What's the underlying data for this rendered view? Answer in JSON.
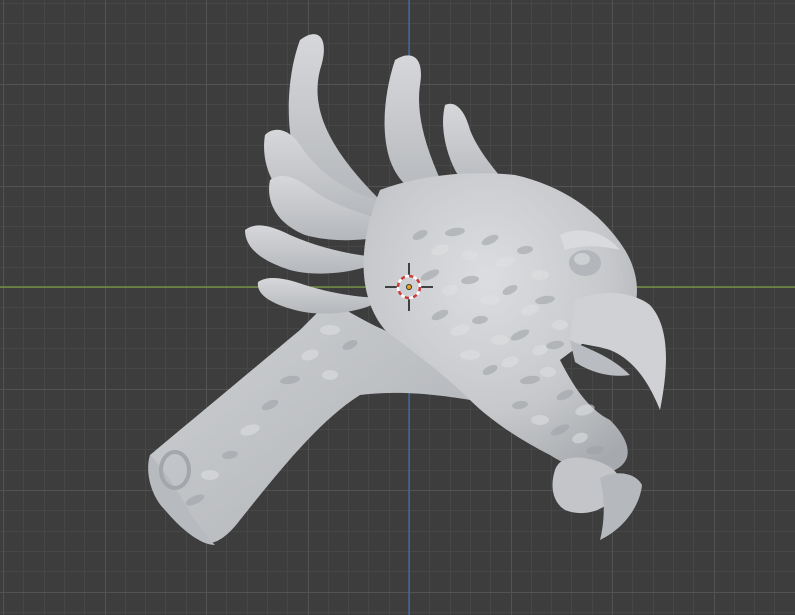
{
  "viewport": {
    "background": "#3d3d3d",
    "grid_minor_color": "#474747",
    "grid_major_color": "#535353",
    "x_axis_color": "#7a9c3c",
    "y_axis_color": "#3f6fa8"
  },
  "cursor": {
    "icon": "3d-cursor-icon",
    "ring_colors": [
      "#cc3a3a",
      "#ffffff"
    ],
    "center_color": "#e0a020"
  },
  "model": {
    "icon": "sculpted-griffin-head",
    "base_color": "#c4c6c9",
    "shadow_color": "#9da0a4",
    "highlight_color": "#dfe0e2"
  }
}
